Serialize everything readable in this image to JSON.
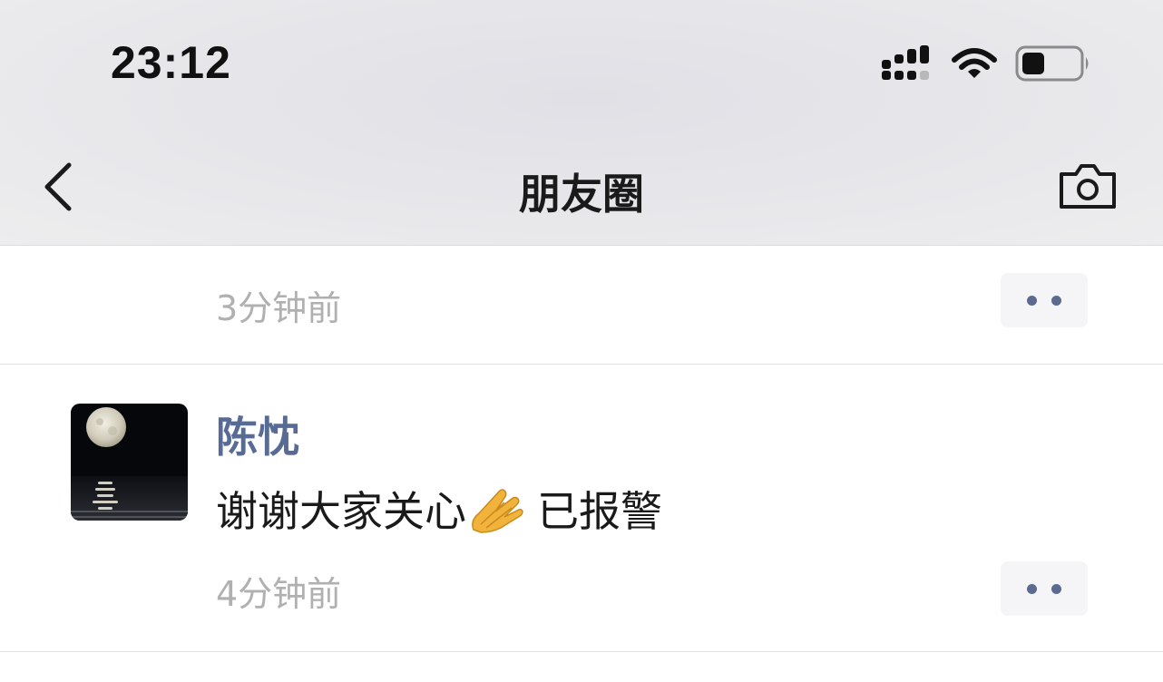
{
  "status_bar": {
    "time": "23:12",
    "icons": [
      "cellular-signal-icon",
      "wifi-icon",
      "battery-icon"
    ]
  },
  "nav": {
    "back_icon": "chevron-left-icon",
    "title": "朋友圈",
    "camera_icon": "camera-icon"
  },
  "feed": {
    "previous_post": {
      "time": "3分钟前"
    },
    "post": {
      "author": "陈忱",
      "content_before": "谢谢大家关心",
      "content_emoji": "pray-emoji",
      "content_after": "已报警",
      "time": "4分钟前"
    }
  },
  "colors": {
    "author_link": "#576b95",
    "timestamp": "#b0b0b0",
    "more_dots": "#5b6a8f",
    "more_bg": "#f5f5f7"
  }
}
